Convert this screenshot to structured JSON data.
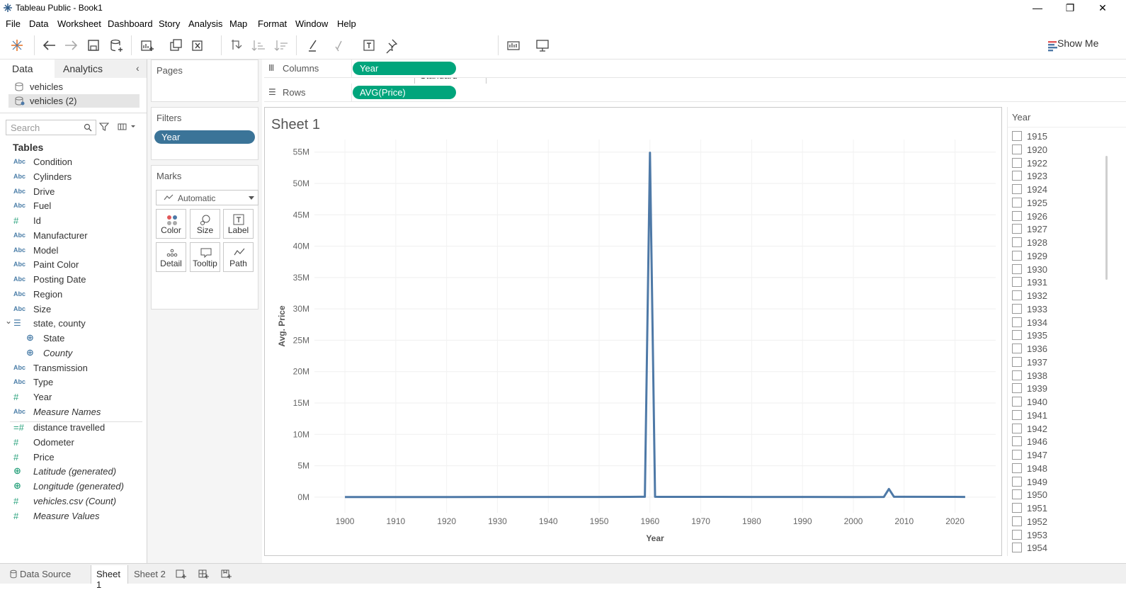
{
  "window": {
    "title": "Tableau Public - Book1"
  },
  "menu": [
    "File",
    "Data",
    "Worksheet",
    "Dashboard",
    "Story",
    "Analysis",
    "Map",
    "Format",
    "Window",
    "Help"
  ],
  "toolbar": {
    "fit": "Standard",
    "show_me": "Show Me"
  },
  "datapane": {
    "tabs": [
      "Data",
      "Analytics"
    ],
    "sources": [
      "vehicles",
      "vehicles (2)"
    ],
    "search_placeholder": "Search",
    "tables_heading": "Tables",
    "fields": [
      {
        "icon": "Abc",
        "name": "Condition"
      },
      {
        "icon": "Abc",
        "name": "Cylinders"
      },
      {
        "icon": "Abc",
        "name": "Drive"
      },
      {
        "icon": "Abc",
        "name": "Fuel"
      },
      {
        "icon": "#",
        "name": "Id"
      },
      {
        "icon": "Abc",
        "name": "Manufacturer"
      },
      {
        "icon": "Abc",
        "name": "Model"
      },
      {
        "icon": "Abc",
        "name": "Paint Color"
      },
      {
        "icon": "Abc",
        "name": "Posting Date"
      },
      {
        "icon": "Abc",
        "name": "Region"
      },
      {
        "icon": "Abc",
        "name": "Size"
      },
      {
        "icon": "hier",
        "name": "state, county"
      },
      {
        "icon": "globe",
        "name": "State"
      },
      {
        "icon": "globe",
        "name": "County"
      },
      {
        "icon": "Abc",
        "name": "Transmission"
      },
      {
        "icon": "Abc",
        "name": "Type"
      },
      {
        "icon": "#",
        "name": "Year"
      },
      {
        "icon": "Abc",
        "name": "Measure Names"
      }
    ],
    "measures": [
      {
        "icon": "=#",
        "name": "distance travelled"
      },
      {
        "icon": "#",
        "name": "Odometer"
      },
      {
        "icon": "#",
        "name": "Price"
      },
      {
        "icon": "globe",
        "name": "Latitude (generated)"
      },
      {
        "icon": "globe",
        "name": "Longitude (generated)"
      },
      {
        "icon": "#",
        "name": "vehicles.csv (Count)"
      },
      {
        "icon": "#",
        "name": "Measure Values"
      }
    ]
  },
  "cards": {
    "pages": "Pages",
    "filters": "Filters",
    "filter_pill": "Year",
    "marks": "Marks",
    "mark_type": "Automatic",
    "mark_buttons": [
      "Color",
      "Size",
      "Label",
      "Detail",
      "Tooltip",
      "Path"
    ]
  },
  "shelves": {
    "columns_label": "Columns",
    "columns_pill": "Year",
    "rows_label": "Rows",
    "rows_pill": "AVG(Price)"
  },
  "sheet_title": "Sheet 1",
  "legend": {
    "title": "Year",
    "items": [
      "1915",
      "1920",
      "1922",
      "1923",
      "1924",
      "1925",
      "1926",
      "1927",
      "1928",
      "1929",
      "1930",
      "1931",
      "1932",
      "1933",
      "1934",
      "1935",
      "1936",
      "1937",
      "1938",
      "1939",
      "1940",
      "1941",
      "1942",
      "1946",
      "1947",
      "1948",
      "1949",
      "1950",
      "1951",
      "1952",
      "1953",
      "1954"
    ]
  },
  "bottom_tabs": [
    "Data Source",
    "Sheet 1",
    "Sheet 2"
  ],
  "colors": {
    "line": "#4e79a7",
    "pill_blue": "#3b7498",
    "pill_green": "#00a57c"
  },
  "chart_data": {
    "type": "line",
    "xlabel": "Year",
    "ylabel": "Avg. Price",
    "xlim": [
      1894,
      2028
    ],
    "ylim": [
      -2.5,
      57
    ],
    "x_ticks": [
      1900,
      1910,
      1920,
      1930,
      1940,
      1950,
      1960,
      1970,
      1980,
      1990,
      2000,
      2010,
      2020
    ],
    "y_ticks": [
      0,
      5,
      10,
      15,
      20,
      25,
      30,
      35,
      40,
      45,
      50,
      55
    ],
    "y_tick_labels": [
      "0M",
      "5M",
      "10M",
      "15M",
      "20M",
      "25M",
      "30M",
      "35M",
      "40M",
      "45M",
      "50M",
      "55M"
    ],
    "series": [
      {
        "x": [
          1900,
          1920,
          1930,
          1950,
          1958,
          1959,
          1960,
          1961,
          1962,
          1970,
          1980,
          2000,
          2006,
          2007,
          2008,
          2020,
          2022
        ],
        "values": [
          0.02,
          0.02,
          0.03,
          0.03,
          0.05,
          0.05,
          54.9,
          0.05,
          0.04,
          0.04,
          0.03,
          0.02,
          0.03,
          1.3,
          0.05,
          0.04,
          0.03
        ]
      }
    ]
  }
}
